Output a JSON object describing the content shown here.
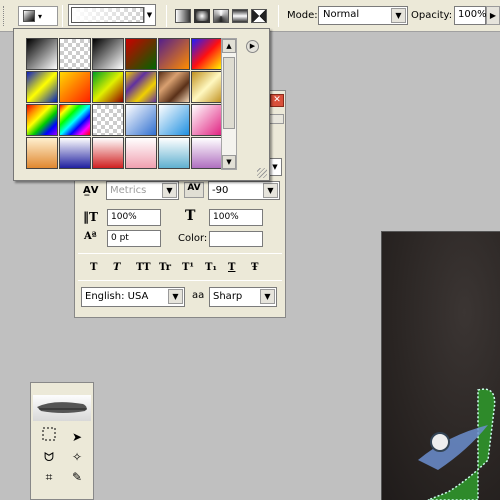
{
  "options_bar": {
    "mode_label": "Mode:",
    "mode_value": "Normal",
    "opacity_label": "Opacity:",
    "opacity_value": "100%"
  },
  "gradient_popup": {
    "gradients": [
      "linear-gradient(135deg,#000,#fff)",
      "repeating-conic-gradient(#ccc 0% 25%,#fff 0% 50%) 0 0/8px 8px",
      "linear-gradient(135deg,#000,#fff)",
      "linear-gradient(135deg,#c00,#060)",
      "linear-gradient(135deg,#541f8c,#ff8c00)",
      "linear-gradient(135deg,#1c1cff,#ff1010,#ffff00)",
      "linear-gradient(135deg,#1020c0,#ffff00,#0020c0)",
      "linear-gradient(135deg,#ffd800,#ff2000)",
      "linear-gradient(135deg,#00a020,#e0f000,#900000)",
      "linear-gradient(135deg,#f0d000,#6030a0,#f0d000,#6030a0)",
      "linear-gradient(135deg,#5a3018,#d8a070,#5a3018,#f5d8b8)",
      "linear-gradient(135deg,#c09020,#fff8c0,#c09020)",
      "linear-gradient(135deg,#e00,#f80,#ff0,#0c0,#00f,#90f)",
      "linear-gradient(135deg,#f00,#ff0,#0f0,#0ff,#00f,#f0f,#f00)",
      "repeating-conic-gradient(#ccc 0% 25%,#fff 0% 50%) 0 0/8px 8px",
      "linear-gradient(135deg,#ffffff,#3070d0)",
      "linear-gradient(135deg,#ffffff,#2090e0)",
      "linear-gradient(135deg,#ffffff,#e02080)",
      "linear-gradient(180deg,#fff0d0,#e08830)",
      "linear-gradient(180deg,#ffffff,#2020a0)",
      "linear-gradient(180deg,#ffffff,#d02020)",
      "linear-gradient(180deg,#ffffff,#f0a0b0)",
      "linear-gradient(180deg,#ffffff,#60b0d0)",
      "linear-gradient(180deg,#ffffff,#b070c0)"
    ]
  },
  "character_panel": {
    "kerning_value": "Metrics",
    "tracking_value": "-90",
    "vertical_scale": "100%",
    "horizontal_scale": "100%",
    "baseline_shift": "0 pt",
    "color_label": "Color:",
    "style_buttons": [
      "T",
      "T",
      "TT",
      "Tr",
      "T¹",
      "T₁",
      "T",
      "Ŧ"
    ],
    "language": "English: USA",
    "aa_label": "aa",
    "antialias": "Sharp"
  }
}
